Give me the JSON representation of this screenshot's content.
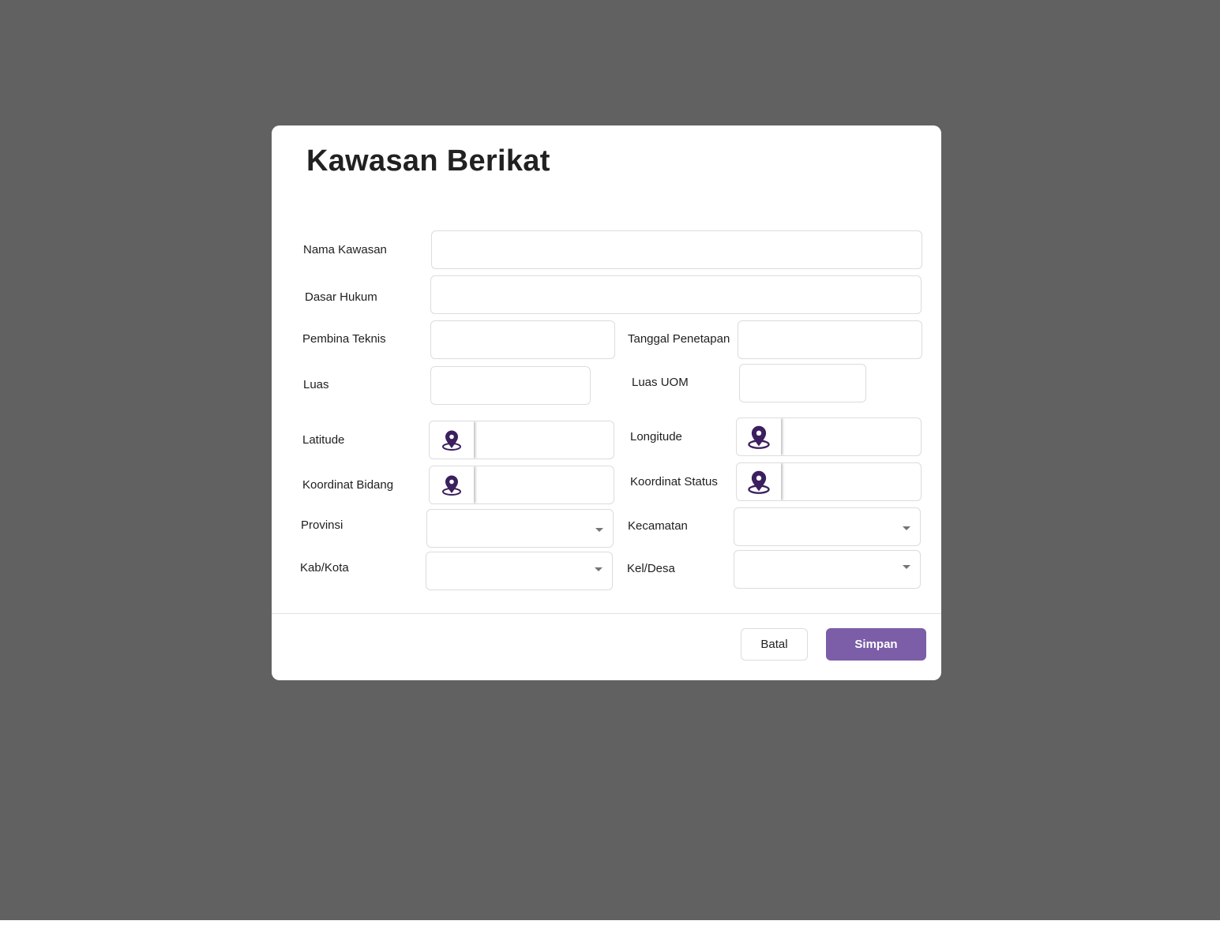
{
  "dialog": {
    "title": "Kawasan Berikat"
  },
  "form": {
    "nama_kawasan": {
      "label": "Nama Kawasan",
      "value": ""
    },
    "dasar_hukum": {
      "label": "Dasar Hukum",
      "value": ""
    },
    "pembina_teknis": {
      "label": "Pembina Teknis",
      "value": ""
    },
    "tanggal_penetapan": {
      "label": "Tanggal Penetapan",
      "value": ""
    },
    "luas": {
      "label": "Luas",
      "value": ""
    },
    "luas_uom": {
      "label": "Luas UOM",
      "value": ""
    },
    "latitude": {
      "label": "Latitude",
      "value": "",
      "icon": "map-pin-icon"
    },
    "longitude": {
      "label": "Longitude",
      "value": "",
      "icon": "map-pin-icon"
    },
    "koordinat_bidang": {
      "label": "Koordinat Bidang",
      "value": "",
      "icon": "map-pin-icon"
    },
    "koordinat_status": {
      "label": "Koordinat Status",
      "value": "",
      "icon": "map-pin-icon"
    },
    "provinsi": {
      "label": "Provinsi",
      "selected": ""
    },
    "kecamatan": {
      "label": "Kecamatan",
      "selected": ""
    },
    "kab_kota": {
      "label": "Kab/Kota",
      "selected": ""
    },
    "kel_desa": {
      "label": "Kel/Desa",
      "selected": ""
    }
  },
  "footer": {
    "cancel_label": "Batal",
    "save_label": "Simpan"
  },
  "colors": {
    "overlay": "#616161",
    "accent": "#7b5ea7",
    "pin_icon": "#3b1f5e"
  }
}
